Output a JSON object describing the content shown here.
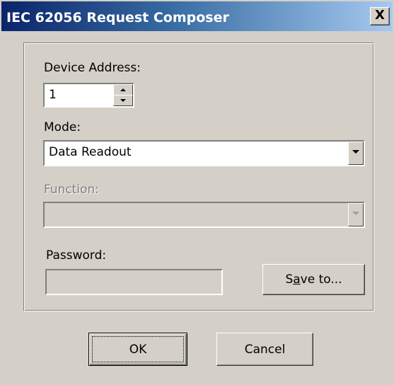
{
  "window": {
    "title": "IEC 62056 Request Composer",
    "close_glyph": "X"
  },
  "device_address": {
    "label": "Device Address:",
    "value": "1"
  },
  "mode": {
    "label": "Mode:",
    "selected": "Data Readout"
  },
  "function": {
    "label": "Function:",
    "selected": "",
    "enabled": false
  },
  "password": {
    "label": "Password:",
    "value": "",
    "enabled": false
  },
  "buttons": {
    "save_pre": "S",
    "save_mnemonic": "a",
    "save_post": "ve to...",
    "ok": "OK",
    "cancel": "Cancel"
  }
}
